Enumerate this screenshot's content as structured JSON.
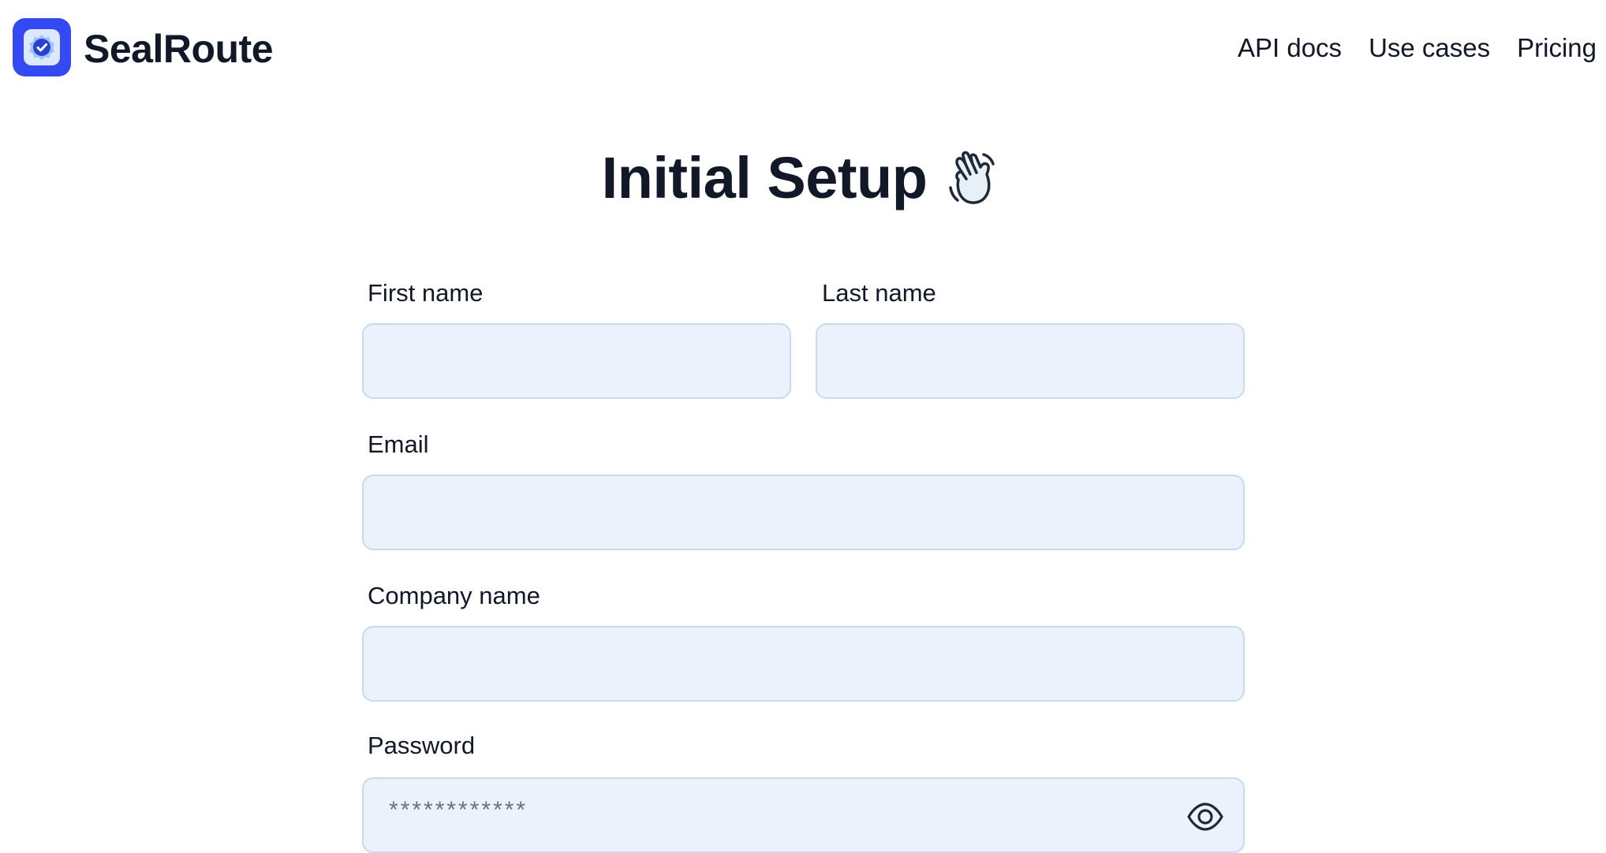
{
  "header": {
    "brand": "SealRoute",
    "logo_icon": "verified-badge-icon",
    "nav": [
      {
        "label": "API docs"
      },
      {
        "label": "Use cases"
      },
      {
        "label": "Pricing"
      }
    ]
  },
  "page": {
    "title": "Initial Setup",
    "title_icon": "waving-hand-icon"
  },
  "form": {
    "first_name": {
      "label": "First name",
      "value": "",
      "placeholder": ""
    },
    "last_name": {
      "label": "Last name",
      "value": "",
      "placeholder": ""
    },
    "email": {
      "label": "Email",
      "value": "",
      "placeholder": ""
    },
    "company": {
      "label": "Company name",
      "value": "",
      "placeholder": ""
    },
    "password": {
      "label": "Password",
      "value": "",
      "placeholder": "************",
      "toggle_icon": "eye-icon"
    }
  },
  "colors": {
    "brand": "#3349f4",
    "text": "#111827",
    "field_bg": "#ebf2fb",
    "field_border": "#c9dbf0"
  }
}
